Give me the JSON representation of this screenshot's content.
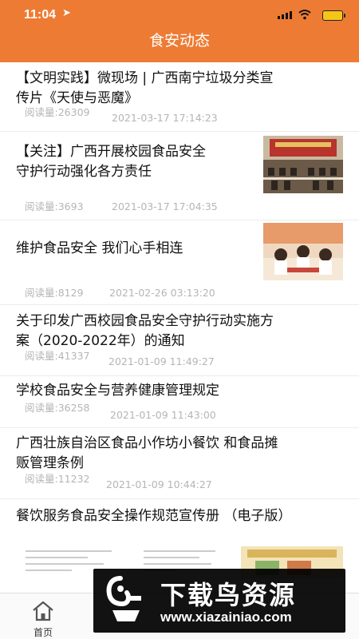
{
  "status_bar": {
    "time": "11:04",
    "location_icon": "location-arrow-icon",
    "signal_icon": "cellular-signal-icon",
    "wifi_icon": "wifi-icon",
    "battery_icon": "battery-charging-icon"
  },
  "header": {
    "title": "食安动态"
  },
  "articles": [
    {
      "title_line1": "【文明实践】微现场 | 广西南宁垃圾分类宣",
      "title_line2": "传片《天使与恶魔》",
      "reads": "阅读量:26309",
      "date": "2021-03-17 17:14:23",
      "has_image": false
    },
    {
      "title_line1": "【关注】广西开展校园食品安全",
      "title_line2": "守护行动强化各方责任",
      "reads": "阅读量:3693",
      "date": "2021-03-17 17:04:35",
      "has_image": true
    },
    {
      "title_line1": "维护食品安全 我们心手相连",
      "title_line2": "",
      "reads": "阅读量:8129",
      "date": "2021-02-26 03:13:20",
      "has_image": true
    },
    {
      "title_line1": "关于印发广西校园食品安全守护行动实施方",
      "title_line2": "案（2020-2022年）的通知",
      "reads": "阅读量:41337",
      "date": "2021-01-09 11:49:27",
      "has_image": false
    },
    {
      "title_line1": "学校食品安全与营养健康管理规定",
      "title_line2": "",
      "reads": "阅读量:36258",
      "date": "2021-01-09 11:43:00",
      "has_image": false
    },
    {
      "title_line1": "广西壮族自治区食品小作坊小餐饮 和食品摊",
      "title_line2": "贩管理条例",
      "reads": "阅读量:11232",
      "date": "2021-01-09 10:44:27",
      "has_image": false
    },
    {
      "title_line1": "餐饮服务食品安全操作规范宣传册 （电子版）",
      "title_line2": "",
      "reads": "",
      "date": "",
      "has_image": true
    }
  ],
  "tabbar": {
    "home_label": "首页",
    "home_icon": "home-icon"
  },
  "watermark": {
    "text": "下载鸟资源",
    "url": "www.xiazainiao.com",
    "icon": "xiazainiao-logo-icon"
  },
  "colors": {
    "header": "#ee7b33",
    "meta_text": "#b5b5b5"
  }
}
